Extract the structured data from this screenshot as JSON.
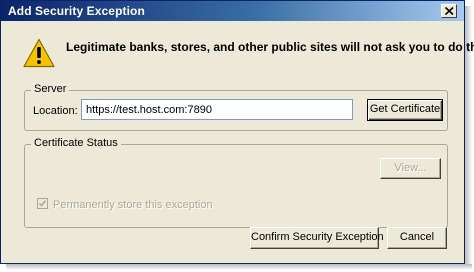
{
  "window": {
    "title": "Add Security Exception",
    "close_icon": "close-icon"
  },
  "warning": {
    "icon": "warning-icon",
    "message": "Legitimate banks, stores, and other public sites will not ask you to do this."
  },
  "server": {
    "legend": "Server",
    "location_label": "Location:",
    "location_value": "https://test.host.com:7890",
    "get_certificate_label": "Get Certificate"
  },
  "certificate_status": {
    "legend": "Certificate Status",
    "view_label": "View...",
    "permanent_label": "Permanently store this exception",
    "permanent_checked": true,
    "permanent_enabled": false
  },
  "buttons": {
    "confirm_label": "Confirm Security Exception",
    "cancel_label": "Cancel"
  },
  "colors": {
    "titlebar_start": "#0a246a",
    "titlebar_end": "#a6caf0",
    "dialog_bg": "#ece9d8",
    "warning_yellow": "#f5c400"
  }
}
